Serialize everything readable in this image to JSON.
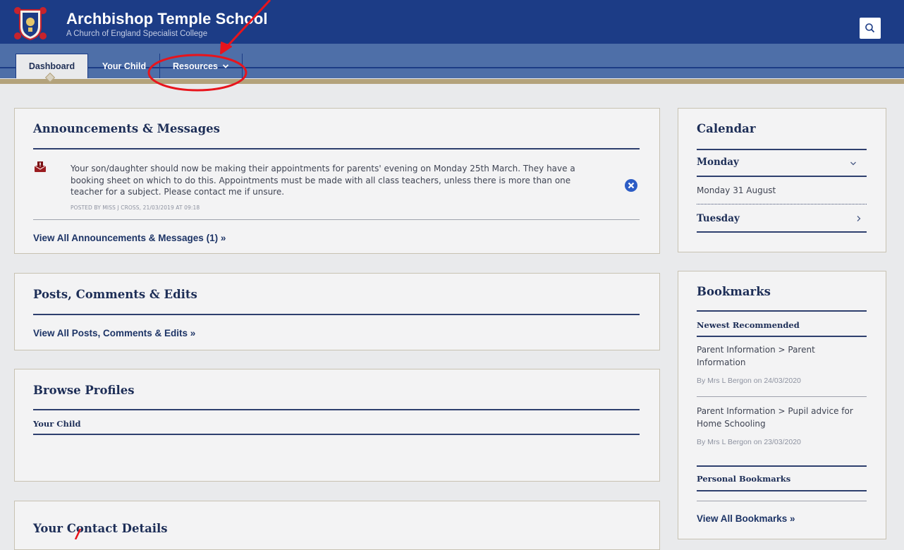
{
  "header": {
    "title": "Archbishop Temple School",
    "subtitle": "A Church of England Specialist College"
  },
  "nav": {
    "tabs": [
      {
        "label": "Dashboard"
      },
      {
        "label": "Your Child"
      },
      {
        "label": "Resources"
      }
    ]
  },
  "announcements": {
    "title": "Announcements & Messages",
    "message": "Your son/daughter should now be making their appointments for parents' evening on Monday 25th March. They have a booking sheet on which to do this. Appointments must be made with all class teachers, unless there is more than one teacher for a subject. Please contact me if unsure.",
    "posted_by": "POSTED BY MISS J CROSS, 21/03/2019 AT 09:18",
    "view_all": "View All Announcements & Messages (1) »"
  },
  "posts": {
    "title": "Posts, Comments & Edits",
    "view_all": "View All Posts, Comments & Edits »"
  },
  "profiles": {
    "title": "Browse Profiles",
    "sub": "Your Child"
  },
  "contact": {
    "title": "Your Contact Details"
  },
  "calendar": {
    "title": "Calendar",
    "day1": "Monday",
    "day1_detail": "Monday 31 August",
    "day2": "Tuesday"
  },
  "bookmarks": {
    "title": "Bookmarks",
    "newest": "Newest Recommended",
    "items": [
      {
        "title": "Parent Information > Parent Information",
        "by": "By Mrs L Bergon on 24/03/2020"
      },
      {
        "title": "Parent Information > Pupil advice for Home Schooling",
        "by": "By Mrs L Bergon on 23/03/2020"
      }
    ],
    "personal": "Personal Bookmarks",
    "view_all": "View All Bookmarks »"
  },
  "colors": {
    "brand": "#1c3c86",
    "nav": "#4e6fa8",
    "annotation": "#e8141c"
  }
}
